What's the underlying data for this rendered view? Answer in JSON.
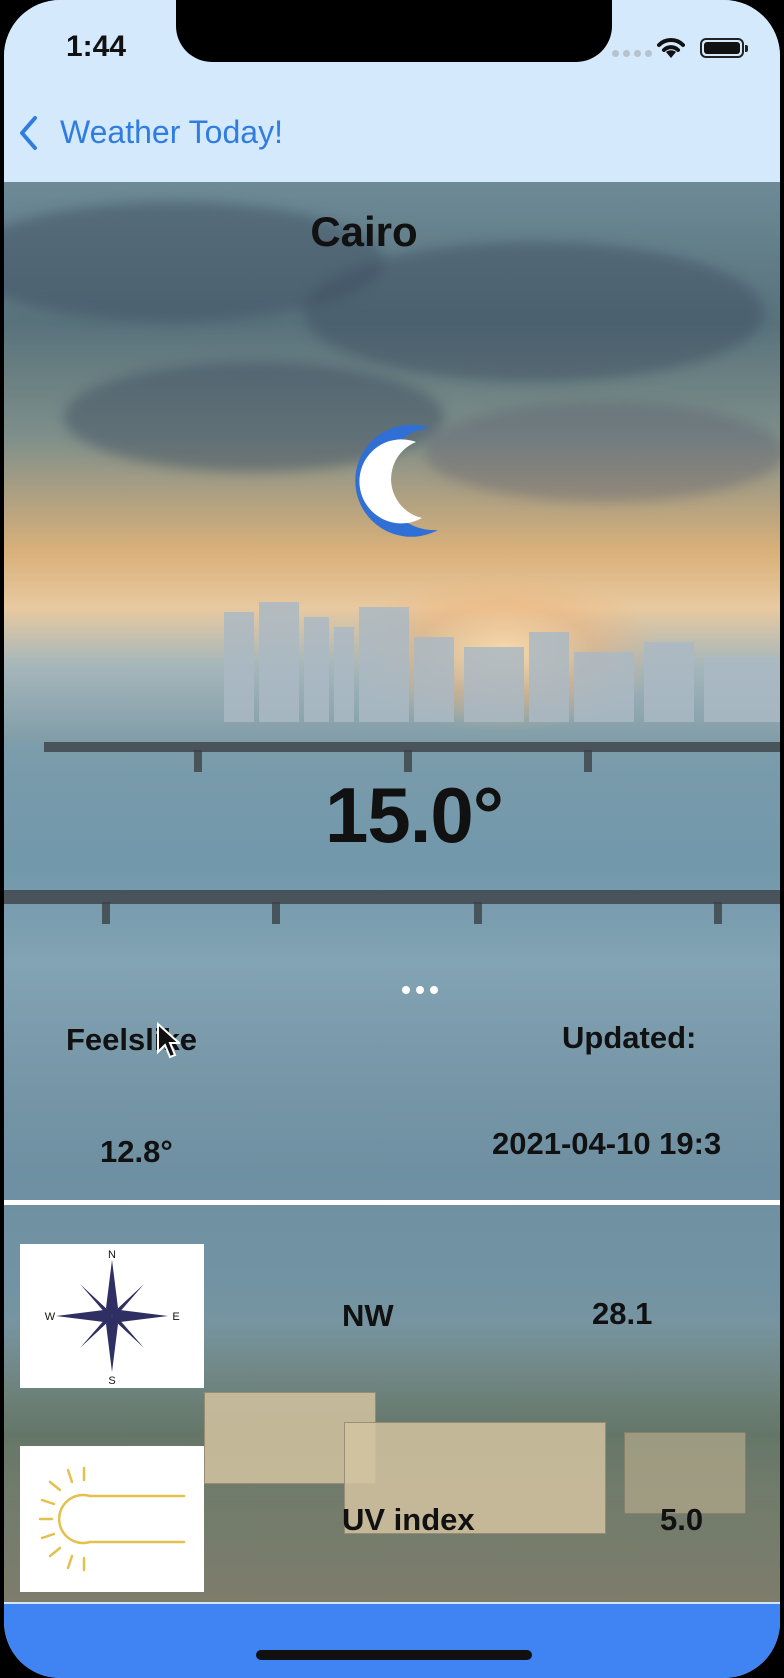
{
  "status": {
    "time": "1:44"
  },
  "nav": {
    "back_label": "Weather Today!"
  },
  "weather": {
    "city": "Cairo",
    "condition_icon": "moon-icon",
    "temperature": "15.0°",
    "feels_like_label": "Feelslike",
    "feels_like_value": "12.8°",
    "updated_label": "Updated:",
    "updated_value": "2021-04-10 19:3",
    "wind_icon": "compass-icon",
    "wind_direction": "NW",
    "wind_speed": "28.1",
    "compass_labels": {
      "n": "N",
      "s": "S",
      "e": "E",
      "w": "W"
    },
    "uv_icon": "sun-icon",
    "uv_label": "UV index",
    "uv_value": "5.0"
  },
  "colors": {
    "accent": "#2f7de1",
    "tabbar": "#3f84f2",
    "moon": "#2f6fd6",
    "compass": "#2f2f63",
    "sun": "#e2c14d"
  }
}
